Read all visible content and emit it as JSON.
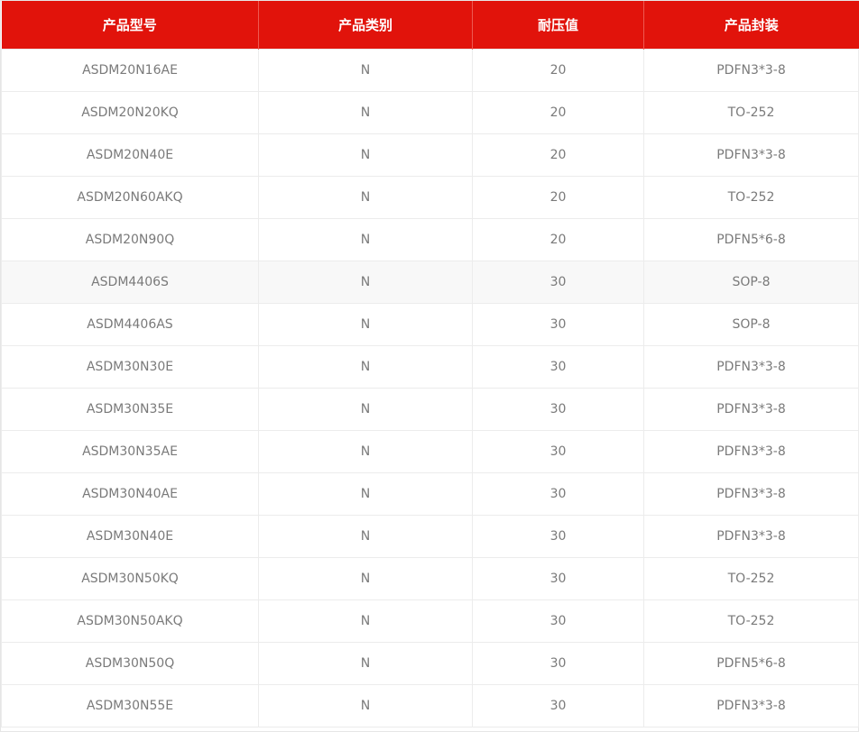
{
  "table": {
    "columns": [
      "产品型号",
      "产品类别",
      "耐压值",
      "产品封装"
    ],
    "rows": [
      [
        "ASDM20N16AE",
        "N",
        "20",
        "PDFN3*3-8"
      ],
      [
        "ASDM20N20KQ",
        "N",
        "20",
        "TO-252"
      ],
      [
        "ASDM20N40E",
        "N",
        "20",
        "PDFN3*3-8"
      ],
      [
        "ASDM20N60AKQ",
        "N",
        "20",
        "TO-252"
      ],
      [
        "ASDM20N90Q",
        "N",
        "20",
        "PDFN5*6-8"
      ],
      [
        "ASDM4406S",
        "N",
        "30",
        "SOP-8"
      ],
      [
        "ASDM4406AS",
        "N",
        "30",
        "SOP-8"
      ],
      [
        "ASDM30N30E",
        "N",
        "30",
        "PDFN3*3-8"
      ],
      [
        "ASDM30N35E",
        "N",
        "30",
        "PDFN3*3-8"
      ],
      [
        "ASDM30N35AE",
        "N",
        "30",
        "PDFN3*3-8"
      ],
      [
        "ASDM30N40AE",
        "N",
        "30",
        "PDFN3*3-8"
      ],
      [
        "ASDM30N40E",
        "N",
        "30",
        "PDFN3*3-8"
      ],
      [
        "ASDM30N50KQ",
        "N",
        "30",
        "TO-252"
      ],
      [
        "ASDM30N50AKQ",
        "N",
        "30",
        "TO-252"
      ],
      [
        "ASDM30N50Q",
        "N",
        "30",
        "PDFN5*6-8"
      ],
      [
        "ASDM30N55E",
        "N",
        "30",
        "PDFN3*3-8"
      ]
    ],
    "highlighted_row": 5
  },
  "colors": {
    "header_bg": "#e1130b",
    "header_text": "#ffffff",
    "cell_text": "#7a7a7a",
    "grid": "#ececec",
    "highlight_bg": "#f8f8f8"
  }
}
